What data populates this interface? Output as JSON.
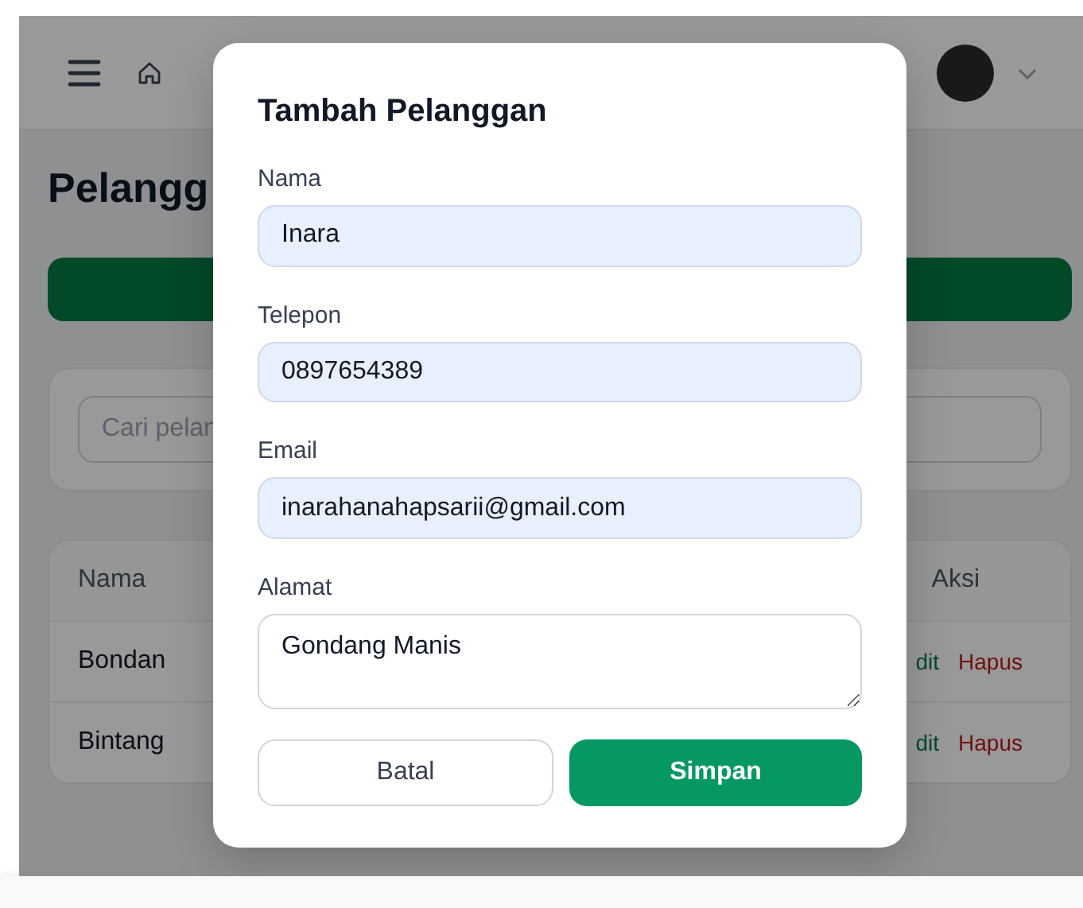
{
  "page": {
    "title": "Pelangg",
    "search": {
      "placeholder": "Cari pelan"
    },
    "table": {
      "columns": [
        "Nama",
        "Aksi"
      ],
      "rows": [
        {
          "name": "Bondan",
          "edit": "dit",
          "delete": "Hapus"
        },
        {
          "name": "Bintang",
          "edit": "dit",
          "delete": "Hapus"
        }
      ]
    }
  },
  "dialog": {
    "title": "Tambah Pelanggan",
    "fields": [
      {
        "kind": "input",
        "label": "Nama",
        "value": "Inara"
      },
      {
        "kind": "input",
        "label": "Telepon",
        "value": "0897654389"
      },
      {
        "kind": "input",
        "label": "Email",
        "value": "inarahanahapsarii@gmail.com"
      },
      {
        "kind": "textarea",
        "label": "Alamat",
        "value": "Gondang Manis"
      }
    ],
    "buttons": [
      {
        "kind": "secondary",
        "label": "Batal"
      },
      {
        "kind": "primary",
        "label": "Simpan"
      }
    ]
  }
}
